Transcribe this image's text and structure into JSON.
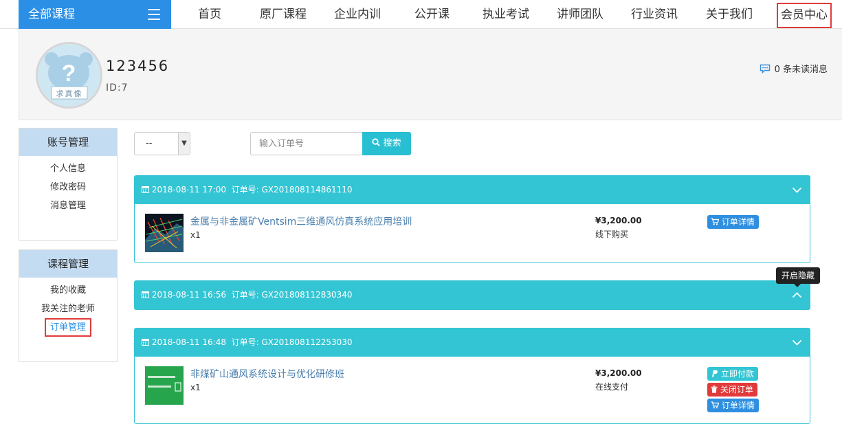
{
  "nav": {
    "all_courses": "全部课程",
    "items": [
      "首页",
      "原厂课程",
      "企业内训",
      "公开课",
      "执业考试",
      "讲师团队",
      "行业资讯",
      "关于我们",
      "会员中心"
    ]
  },
  "profile": {
    "username": "123456",
    "user_id": "ID:7",
    "messages": "0 条未读消息",
    "avatar_text": "求真像"
  },
  "sidebar": {
    "account": {
      "title": "账号管理",
      "items": [
        "个人信息",
        "修改密码",
        "消息管理"
      ]
    },
    "courses": {
      "title": "课程管理",
      "items": [
        "我的收藏",
        "我关注的老师",
        "订单管理"
      ]
    }
  },
  "filter": {
    "select_value": "--",
    "search_placeholder": "输入订单号",
    "search_label": "搜索"
  },
  "tooltip": "开启隐藏",
  "orders": [
    {
      "datetime": "2018-08-11 17:00",
      "order_no_label": "订单号:",
      "order_no": "GX201808114861110",
      "title": "金属与非金属矿Ventsim三维通风仿真系统应用培训",
      "qty": "x1",
      "price": "¥3,200.00",
      "pay_type": "线下购买",
      "buttons": [
        "订单详情"
      ]
    },
    {
      "datetime": "2018-08-11 16:56",
      "order_no_label": "订单号:",
      "order_no": "GX201808112830340"
    },
    {
      "datetime": "2018-08-11 16:48",
      "order_no_label": "订单号:",
      "order_no": "GX201808112253030",
      "title": "非煤矿山通风系统设计与优化研修班",
      "qty": "x1",
      "price": "¥3,200.00",
      "pay_type": "在线支付",
      "buttons": [
        "立即付款",
        "关闭订单",
        "订单详情"
      ]
    }
  ],
  "colors": {
    "brand_blue": "#2b8fe6",
    "teal": "#33c5d4",
    "highlight_red": "#e03a3a"
  }
}
